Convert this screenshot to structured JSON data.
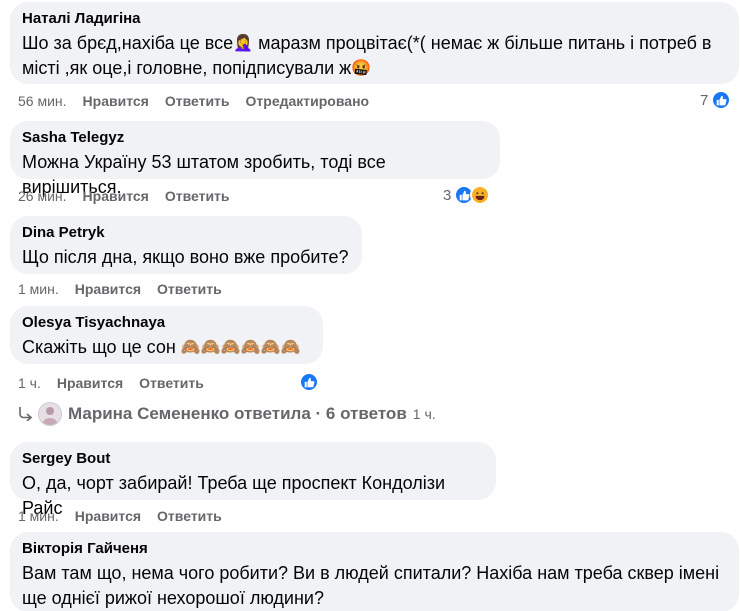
{
  "comments": [
    {
      "author": "Наталі Ладигіна",
      "text_parts": [
        "Шо за брєд,нахіба це все",
        " маразм процвітає(*( немає ж більше питань і потреб в",
        "місті ,як оце,і головне, попідписували ж"
      ],
      "time": "56 мин.",
      "like": "Нравится",
      "reply": "Ответить",
      "edited": "Отредактировано",
      "reaction_count": "7"
    },
    {
      "author": "Sasha Telegyz",
      "text": "Можна Україну 53 штатом зробить, тоді все вирішиться.",
      "time": "26 мин.",
      "like": "Нравится",
      "reply": "Ответить",
      "reaction_count": "3"
    },
    {
      "author": "Dina Petryk",
      "text": "Що після дна, якщо воно вже пробите?",
      "time": "1 мин.",
      "like": "Нравится",
      "reply": "Ответить"
    },
    {
      "author": "Olesya Tisyachnaya",
      "text": "Скажіть що це сон",
      "time": "1 ч.",
      "like": "Нравится",
      "reply": "Ответить"
    },
    {
      "author": "Sergey Bout",
      "text": "О, да, чорт забирай! Треба ще проспект Кондолізи Райс",
      "time": "1 мин.",
      "like": "Нравится",
      "reply": "Ответить"
    },
    {
      "author": "Вікторія Гайченя",
      "text_line1": "Вам там що, нема чого робити? Ви в людей спитали? Нахіба нам треба сквер імені",
      "text_line2": "ще однієї рижої нехорошої людини?"
    }
  ],
  "replies_summary": {
    "label": "Марина Семененко ответила · 6 ответов",
    "time": "1 ч."
  },
  "icons": {
    "like": "like-reaction-icon",
    "haha": "haha-reaction-icon",
    "facepalm": "facepalm-emoji",
    "angry": "angry-emoji",
    "see_no_evil": "see-no-evil-monkey-emoji"
  },
  "colors": {
    "bubble": "#f0f2f5",
    "meta": "#65676b",
    "like_blue": "#1877f2"
  }
}
